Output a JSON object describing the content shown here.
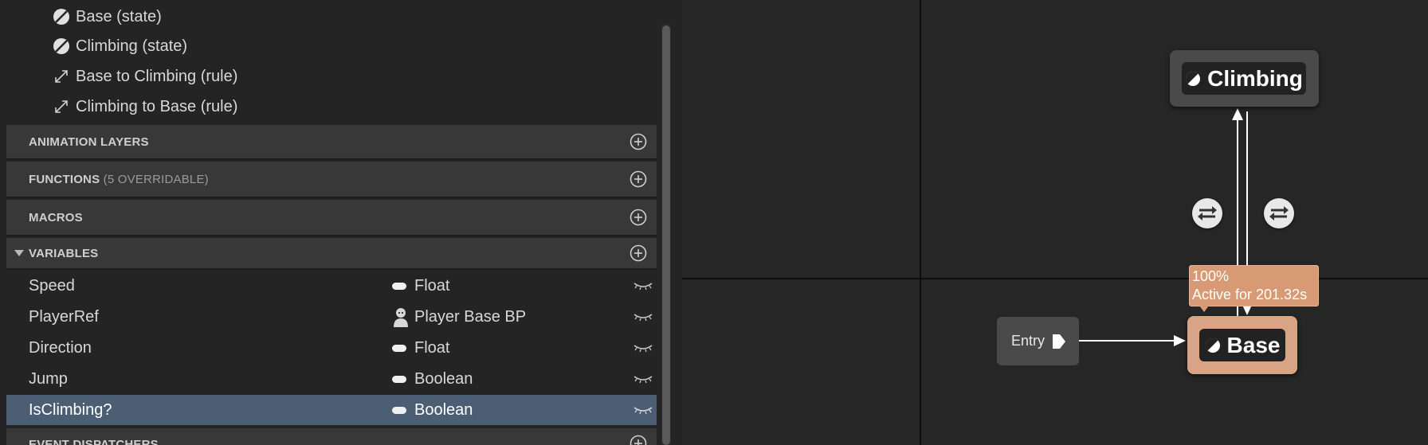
{
  "tree": {
    "items": [
      {
        "label": "Base (state)",
        "icon": "state-icon"
      },
      {
        "label": "Climbing (state)",
        "icon": "state-icon"
      },
      {
        "label": "Base to Climbing (rule)",
        "icon": "rule-icon"
      },
      {
        "label": "Climbing to Base (rule)",
        "icon": "rule-icon"
      }
    ]
  },
  "sections": {
    "animation_layers": "ANIMATION LAYERS",
    "functions": "FUNCTIONS",
    "functions_sub": "(5 OVERRIDABLE)",
    "macros": "MACROS",
    "variables": "VARIABLES",
    "event_dispatchers": "EVENT DISPATCHERS"
  },
  "variables": [
    {
      "name": "Speed",
      "type": "Float",
      "type_icon": "pill-icon",
      "selected": false
    },
    {
      "name": "PlayerRef",
      "type": "Player Base BP",
      "type_icon": "pawn-icon",
      "selected": false
    },
    {
      "name": "Direction",
      "type": "Float",
      "type_icon": "pill-icon",
      "selected": false
    },
    {
      "name": "Jump",
      "type": "Boolean",
      "type_icon": "pill-icon",
      "selected": false
    },
    {
      "name": "IsClimbing?",
      "type": "Boolean",
      "type_icon": "pill-icon",
      "selected": true
    }
  ],
  "graph": {
    "nodes": {
      "climbing": "Climbing",
      "base": "Base",
      "entry": "Entry"
    },
    "tooltip": {
      "line1": "100%",
      "line2": "Active for 201.32s"
    }
  },
  "colors": {
    "active_state": "#d8a485",
    "selected_row": "#4b5e74",
    "section_header": "#383838"
  }
}
